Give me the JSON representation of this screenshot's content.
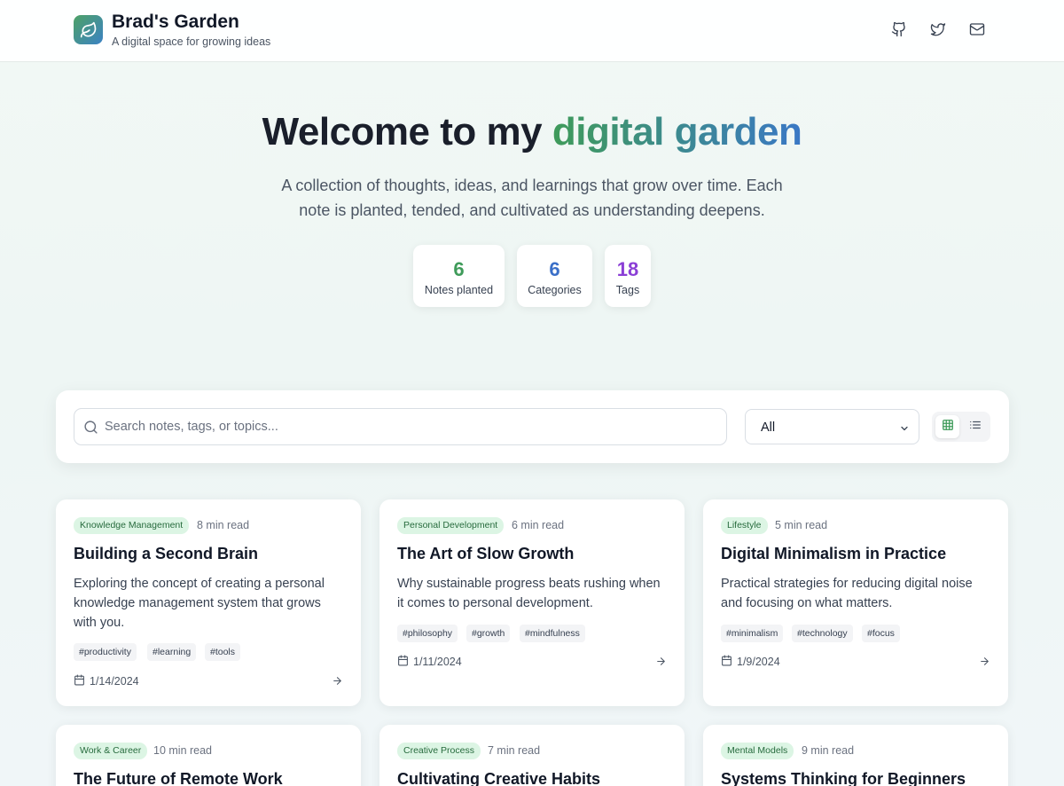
{
  "header": {
    "title": "Brad's Garden",
    "subtitle": "A digital space for growing ideas",
    "icons": [
      "github-icon",
      "twitter-icon",
      "mail-icon"
    ]
  },
  "hero": {
    "title_prefix": "Welcome to my",
    "title_highlight": "digital garden",
    "description": "A collection of thoughts, ideas, and learnings that grow over time. Each note is planted, tended, and cultivated as understanding deepens.",
    "stats": [
      {
        "value": "6",
        "label": "Notes planted",
        "color": "#3f9b5a"
      },
      {
        "value": "6",
        "label": "Categories",
        "color": "#3a6fc8"
      },
      {
        "value": "18",
        "label": "Tags",
        "color": "#8b3fd6"
      }
    ]
  },
  "search": {
    "placeholder": "Search notes, tags, or topics...",
    "value": "",
    "category_selected": "All",
    "view_modes": [
      "grid-icon",
      "list-icon"
    ],
    "active_view": "grid"
  },
  "notes": [
    {
      "category": "Knowledge Management",
      "read_time": "8 min read",
      "title": "Building a Second Brain",
      "description": "Exploring the concept of creating a personal knowledge management system that grows with you.",
      "tags": [
        "#productivity",
        "#learning",
        "#tools"
      ],
      "date": "1/14/2024"
    },
    {
      "category": "Personal Development",
      "read_time": "6 min read",
      "title": "The Art of Slow Growth",
      "description": "Why sustainable progress beats rushing when it comes to personal development.",
      "tags": [
        "#philosophy",
        "#growth",
        "#mindfulness"
      ],
      "date": "1/11/2024"
    },
    {
      "category": "Lifestyle",
      "read_time": "5 min read",
      "title": "Digital Minimalism in Practice",
      "description": "Practical strategies for reducing digital noise and focusing on what matters.",
      "tags": [
        "#minimalism",
        "#technology",
        "#focus"
      ],
      "date": "1/9/2024"
    },
    {
      "category": "Work & Career",
      "read_time": "10 min read",
      "title": "The Future of Remote Work"
    },
    {
      "category": "Creative Process",
      "read_time": "7 min read",
      "title": "Cultivating Creative Habits"
    },
    {
      "category": "Mental Models",
      "read_time": "9 min read",
      "title": "Systems Thinking for Beginners"
    }
  ],
  "colors": {
    "accent_green": "#3f9b5a",
    "accent_blue": "#3a78c5",
    "badge_bg": "#dcf5e4",
    "badge_text": "#276b3d"
  }
}
